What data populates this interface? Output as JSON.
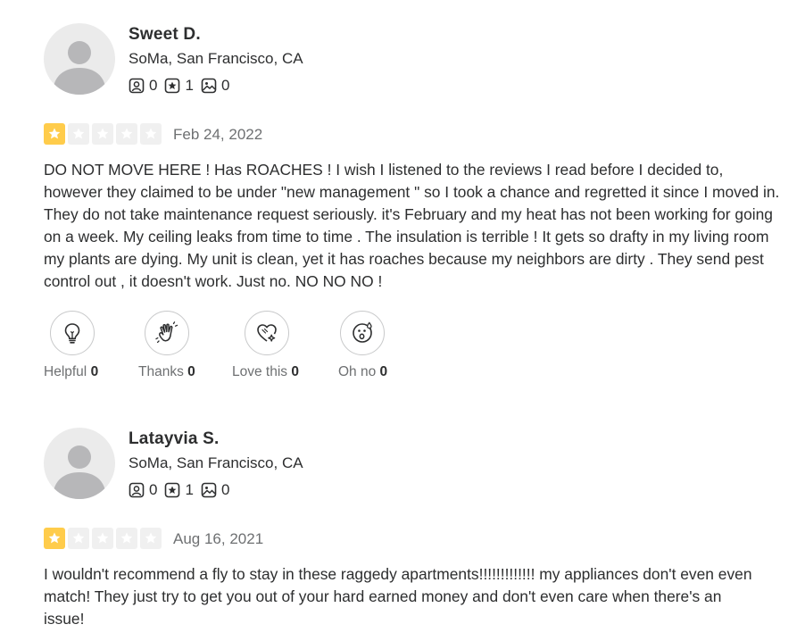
{
  "reviews": [
    {
      "name": "Sweet D.",
      "location": "SoMa, San Francisco, CA",
      "friends": "0",
      "reviews": "1",
      "photos": "0",
      "rating": 1,
      "date": "Feb 24, 2022",
      "text": "DO NOT MOVE HERE ! Has ROACHES ! I wish I listened to the reviews I read before I decided to, however they claimed to be under \"new management \" so I took a chance and regretted it since I moved in. They do not take maintenance request seriously. it's February and my heat has not been working for going on a week. My ceiling leaks from time to time . The insulation is terrible ! It gets so drafty in my living room my plants are dying. My unit is clean, yet it has roaches because my neighbors are dirty . They send pest control out , it doesn't work. Just no. NO NO NO !",
      "reactions": {
        "helpful_label": "Helpful",
        "helpful_count": "0",
        "thanks_label": "Thanks",
        "thanks_count": "0",
        "love_label": "Love this",
        "love_count": "0",
        "ohno_label": "Oh no",
        "ohno_count": "0"
      }
    },
    {
      "name": "Latayvia S.",
      "location": "SoMa, San Francisco, CA",
      "friends": "0",
      "reviews": "1",
      "photos": "0",
      "rating": 1,
      "date": "Aug 16, 2021",
      "text": "I wouldn't recommend a fly to stay in these raggedy apartments!!!!!!!!!!!!! my appliances don't even even match! They just try to get you out of your hard earned money and don't even care when there's an issue!"
    }
  ],
  "icons": {
    "friends": "friends-icon",
    "review_count": "star-badge-icon",
    "photos": "photo-icon",
    "helpful": "lightbulb-icon",
    "thanks": "hand-wave-icon",
    "love": "heart-icon",
    "ohno": "surprised-face-icon"
  },
  "colors": {
    "star_on": "#ffcc4b",
    "star_off": "#f0f0f0",
    "text": "#2d2e2f",
    "muted": "#6e7072"
  }
}
